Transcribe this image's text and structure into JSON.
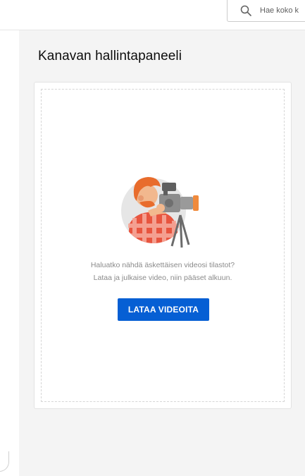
{
  "search": {
    "placeholder": "Hae koko k",
    "icon": "search-icon"
  },
  "main": {
    "title": "Kanavan hallintapaneeli",
    "card": {
      "illustration": "camera-operator-illustration",
      "message_line1": "Haluatko nähdä äskettäisen videosi tilastot?",
      "message_line2": "Lataa ja julkaise video, niin pääset alkuun.",
      "button_label": "LATAA VIDEOITA"
    }
  },
  "colors": {
    "accent": "#065fd4",
    "background": "#f4f4f4",
    "card": "#ffffff"
  }
}
